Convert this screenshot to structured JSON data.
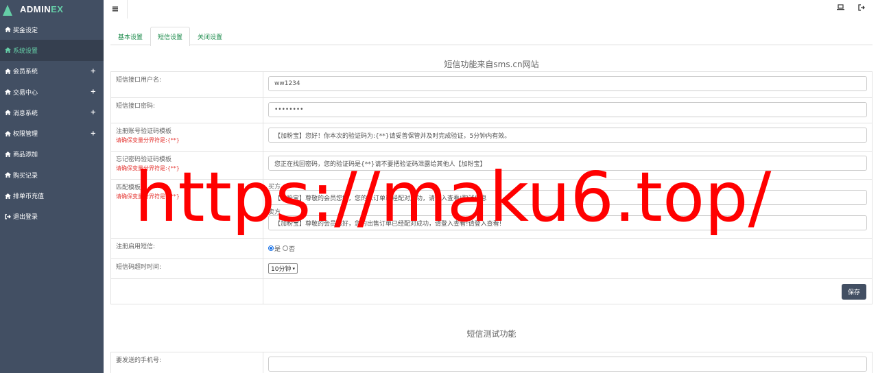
{
  "brand": {
    "name_main": "ADMIN",
    "name_accent": "EX"
  },
  "sidebar": {
    "items": [
      {
        "label": "奖金设定",
        "icon": "home-icon",
        "expandable": false,
        "active": false
      },
      {
        "label": "系统设置",
        "icon": "home-icon",
        "expandable": false,
        "active": true
      },
      {
        "label": "会员系统",
        "icon": "home-icon",
        "expandable": true,
        "active": false
      },
      {
        "label": "交易中心",
        "icon": "home-icon",
        "expandable": true,
        "active": false
      },
      {
        "label": "消息系统",
        "icon": "home-icon",
        "expandable": true,
        "active": false
      },
      {
        "label": "权限管理",
        "icon": "home-icon",
        "expandable": true,
        "active": false
      },
      {
        "label": "商品添加",
        "icon": "home-icon",
        "expandable": false,
        "active": false
      },
      {
        "label": "购买记录",
        "icon": "home-icon",
        "expandable": false,
        "active": false
      },
      {
        "label": "排单币充值",
        "icon": "home-icon",
        "expandable": false,
        "active": false
      },
      {
        "label": "退出登录",
        "icon": "sign-out-icon",
        "expandable": false,
        "active": false
      }
    ],
    "plus_glyph": "+"
  },
  "topbar": {
    "menu_icon": "hamburger-icon",
    "laptop_icon": "laptop-icon",
    "logout_icon": "logout-icon"
  },
  "tabs": [
    {
      "label": "基本设置",
      "active": false
    },
    {
      "label": "短信设置",
      "active": true
    },
    {
      "label": "关闭设置",
      "active": false
    }
  ],
  "sms_section": {
    "title": "短信功能来自sms.cn网站",
    "fields": {
      "username_label": "短信接口用户名:",
      "username_value": "ww1234",
      "password_label": "短信接口密码:",
      "password_value": "••••••••",
      "register_tpl_label": "注册账号验证码模板",
      "register_tpl_hint": "请确保变量分界符是:{**}",
      "register_tpl_value": "【加粉宝】您好！你本次的验证码为:{**}请妥善保管并及时完成验证，5分钟内有效。",
      "forgot_tpl_label": "忘记密码验证码模板",
      "forgot_tpl_hint": "请确保变量分界符是:{**}",
      "forgot_tpl_value": "您正在找回密码，您的验证码是{**}请不要把验证码泄露给其他人【加粉宝】",
      "match_tpl_label": "匹配模板",
      "match_tpl_hint": "请确保变量分界符是:{**}",
      "buyer_label": "买方",
      "buyer_value": "【加粉宝】尊敬的会员您好，您的入订单已经配对成功，请登入查看!取消信息",
      "seller_label": "卖方",
      "seller_value": "【加粉宝】尊敬的会员您好，您的出售订单已经配对成功，请登入查看!请登入查看!",
      "enable_label": "注册启用短信:",
      "enable_yes": "是",
      "enable_no": "否",
      "enable_selected": "yes",
      "timeout_label": "短信码超时时间:",
      "timeout_value": "10分钟"
    },
    "save_label": "保存"
  },
  "test_section": {
    "title": "短信测试功能",
    "phone_label": "要发送的手机号:",
    "phone_value": ""
  },
  "watermark": {
    "text": "https://maku6.top/",
    "color": "#ff0000"
  },
  "colors": {
    "sidebar_bg": "#424f63",
    "accent": "#65cea7",
    "tab_text": "#1a8a4a",
    "hint": "#e53935"
  }
}
